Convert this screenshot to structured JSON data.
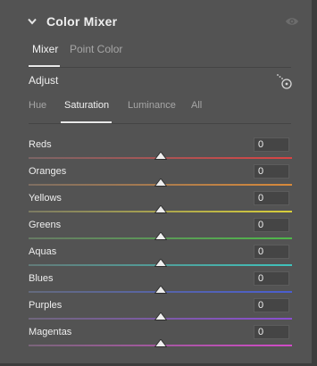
{
  "panel": {
    "title": "Color Mixer",
    "icons": {
      "collapse": "chevron-down-icon",
      "visibility": "eye-icon",
      "targeted_adjust": "targeted-adjustment-icon"
    }
  },
  "mode_tabs": [
    {
      "label": "Mixer",
      "active": true
    },
    {
      "label": "Point Color",
      "active": false
    }
  ],
  "adjust": {
    "label": "Adjust",
    "tabs": [
      {
        "label": "Hue",
        "active": false
      },
      {
        "label": "Saturation",
        "active": true
      },
      {
        "label": "Luminance",
        "active": false
      },
      {
        "label": "All",
        "active": false
      }
    ]
  },
  "sliders": [
    {
      "label": "Reds",
      "value": "0",
      "color_left": "#7a6565",
      "color_right": "#d94444"
    },
    {
      "label": "Oranges",
      "value": "0",
      "color_left": "#7d6e62",
      "color_right": "#d98a3a"
    },
    {
      "label": "Yellows",
      "value": "0",
      "color_left": "#7b7a63",
      "color_right": "#d9cf3a"
    },
    {
      "label": "Greens",
      "value": "0",
      "color_left": "#677a64",
      "color_right": "#4fb84a"
    },
    {
      "label": "Aquas",
      "value": "0",
      "color_left": "#637a78",
      "color_right": "#3fc4bd"
    },
    {
      "label": "Blues",
      "value": "0",
      "color_left": "#646a7c",
      "color_right": "#4a5ed1"
    },
    {
      "label": "Purples",
      "value": "0",
      "color_left": "#6f667c",
      "color_right": "#8a4ed1"
    },
    {
      "label": "Magentas",
      "value": "0",
      "color_left": "#7a657a",
      "color_right": "#d14bc8"
    }
  ]
}
